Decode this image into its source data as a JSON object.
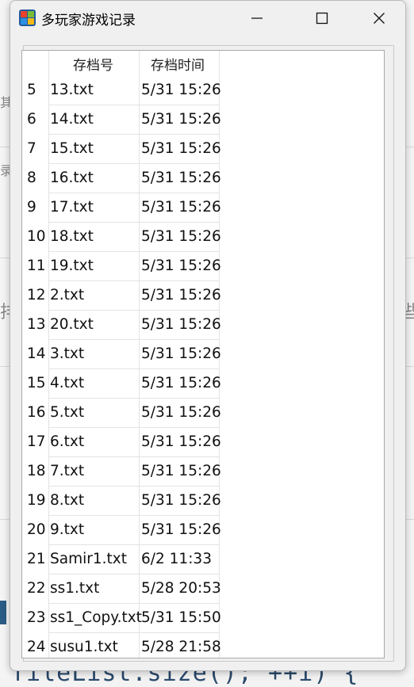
{
  "background": {
    "left_chars": [
      "其",
      "录",
      "排"
    ],
    "right_chars": [
      "些"
    ],
    "code_text": "fileList.size(); ++i) {",
    "accent_color": "#2b4a6b"
  },
  "window": {
    "title": "多玩家游戏记录",
    "icons": {
      "app": "app-logo-icon",
      "minimize": "minimize-icon",
      "maximize": "maximize-icon",
      "close": "close-icon"
    }
  },
  "table": {
    "columns": [
      "存档号",
      "存档时间"
    ],
    "rows": [
      {
        "index": "5",
        "name": "13.txt",
        "time": "5/31 15:26"
      },
      {
        "index": "6",
        "name": "14.txt",
        "time": "5/31 15:26"
      },
      {
        "index": "7",
        "name": "15.txt",
        "time": "5/31 15:26"
      },
      {
        "index": "8",
        "name": "16.txt",
        "time": "5/31 15:26"
      },
      {
        "index": "9",
        "name": "17.txt",
        "time": "5/31 15:26"
      },
      {
        "index": "10",
        "name": "18.txt",
        "time": "5/31 15:26"
      },
      {
        "index": "11",
        "name": "19.txt",
        "time": "5/31 15:26"
      },
      {
        "index": "12",
        "name": "2.txt",
        "time": "5/31 15:26"
      },
      {
        "index": "13",
        "name": "20.txt",
        "time": "5/31 15:26"
      },
      {
        "index": "14",
        "name": "3.txt",
        "time": "5/31 15:26"
      },
      {
        "index": "15",
        "name": "4.txt",
        "time": "5/31 15:26"
      },
      {
        "index": "16",
        "name": "5.txt",
        "time": "5/31 15:26"
      },
      {
        "index": "17",
        "name": "6.txt",
        "time": "5/31 15:26"
      },
      {
        "index": "18",
        "name": "7.txt",
        "time": "5/31 15:26"
      },
      {
        "index": "19",
        "name": "8.txt",
        "time": "5/31 15:26"
      },
      {
        "index": "20",
        "name": "9.txt",
        "time": "5/31 15:26"
      },
      {
        "index": "21",
        "name": "Samir1.txt",
        "time": "6/2 11:33"
      },
      {
        "index": "22",
        "name": "ss1.txt",
        "time": "5/28 20:53"
      },
      {
        "index": "23",
        "name": "ss1_Copy.txt",
        "time": "5/31 15:50"
      },
      {
        "index": "24",
        "name": "susu1.txt",
        "time": "5/28 21:58"
      }
    ]
  }
}
